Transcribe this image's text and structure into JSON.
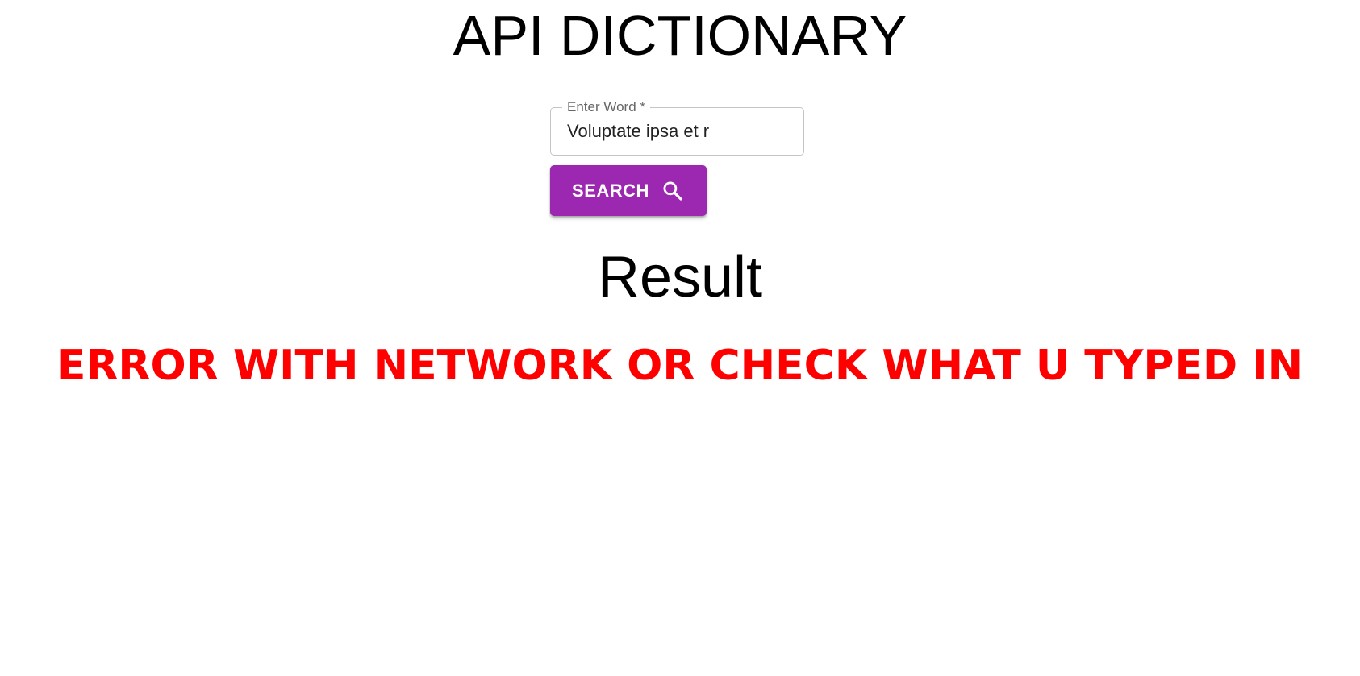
{
  "header": {
    "title": "API DICTIONARY"
  },
  "search": {
    "label": "Enter Word *",
    "value": "Voluptate ipsa et r",
    "button_label": "SEARCH",
    "button_icon": "search-icon",
    "button_color": "#9c27b0"
  },
  "result": {
    "heading": "Result",
    "error_message": "ERROR WITH NETWORK OR CHECK WHAT U TYPED IN",
    "error_color": "#ff0000"
  }
}
